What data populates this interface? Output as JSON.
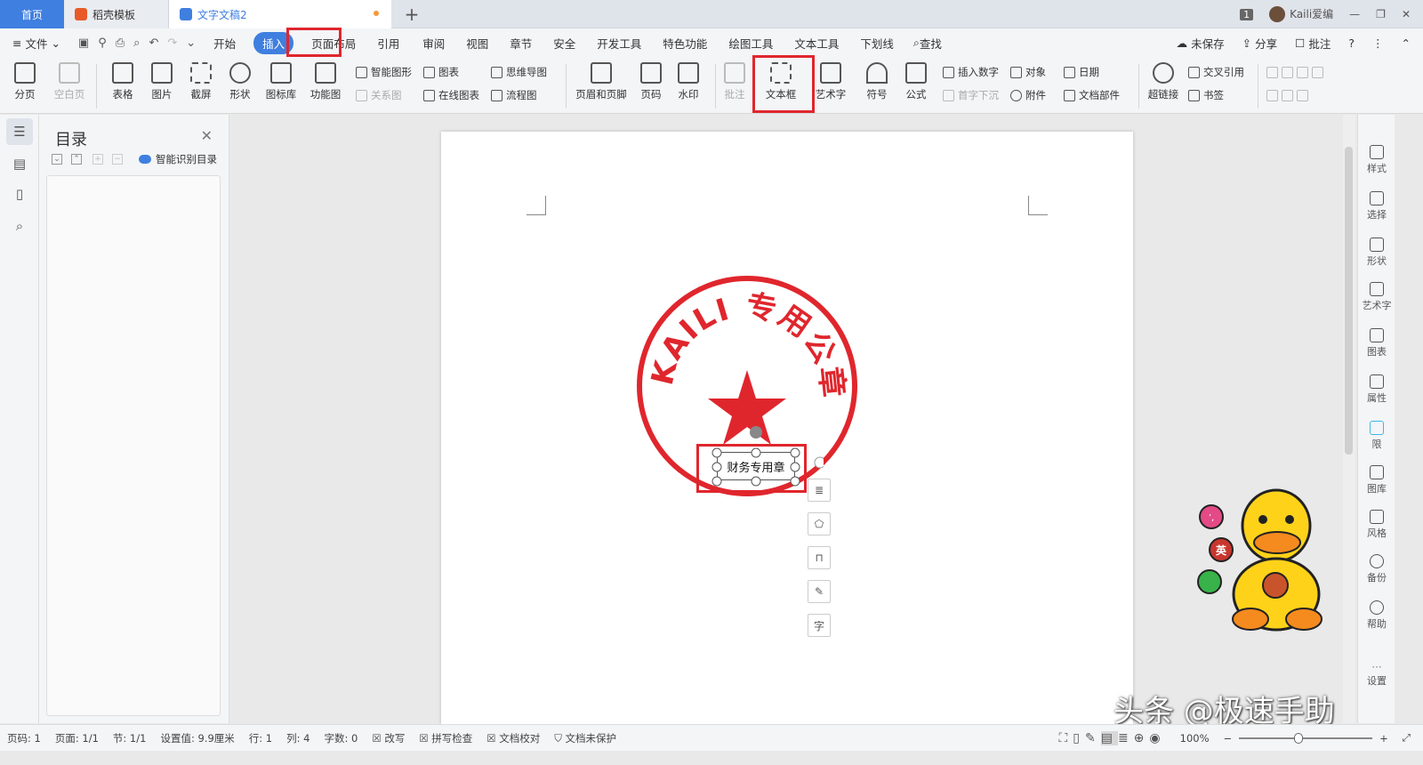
{
  "tabs": {
    "home": "首页",
    "templates": "稻壳模板",
    "doc": "文字文稿2"
  },
  "window": {
    "badge": "1",
    "user": "Kaili爱编"
  },
  "menu": {
    "file": "文件",
    "items": [
      "开始",
      "插入",
      "页面布局",
      "引用",
      "审阅",
      "视图",
      "章节",
      "安全",
      "开发工具",
      "特色功能",
      "绘图工具",
      "文本工具",
      "下划线"
    ],
    "find": "查找",
    "unsaved": "未保存",
    "share": "分享",
    "comment": "批注",
    "help": "?"
  },
  "ribbon": {
    "page_break": "分页",
    "blank_page": "空白页",
    "table": "表格",
    "picture": "图片",
    "screenshot": "截屏",
    "shape": "形状",
    "icon_lib": "图标库",
    "func_chart": "功能图",
    "smart_graphic": "智能图形",
    "chart": "图表",
    "mindmap": "思维导图",
    "relation": "关系图",
    "online_chart": "在线图表",
    "flowchart": "流程图",
    "header_footer": "页眉和页脚",
    "page_num": "页码",
    "watermark": "水印",
    "annotate": "批注",
    "textbox": "文本框",
    "wordart": "艺术字",
    "symbol": "符号",
    "formula": "公式",
    "insert_number": "插入数字",
    "object": "对象",
    "date": "日期",
    "drop_cap": "首字下沉",
    "attachment": "附件",
    "doc_parts": "文档部件",
    "hyperlink": "超链接",
    "cross_ref": "交叉引用",
    "bookmark": "书签"
  },
  "toc": {
    "title": "目录",
    "smart": "智能识别目录"
  },
  "seal": {
    "top_text": "KAILI 专用公章",
    "box_text": "财务专用章",
    "color": "#e0262d"
  },
  "right_panel": [
    "样式",
    "选择",
    "形状",
    "艺术字",
    "图表",
    "属性",
    "限",
    "图库",
    "风格",
    "备份",
    "帮助",
    "设置"
  ],
  "float_tools": [
    "layout-icon",
    "fill-icon",
    "border-icon",
    "pen-icon",
    "text-wrap-icon"
  ],
  "float_text": "字",
  "sticker": {
    "b1": "’,",
    "b2": "英"
  },
  "status": {
    "page": "页码: 1",
    "pages": "页面: 1/1",
    "section": "节: 1/1",
    "setting": "设置值: 9.9厘米",
    "row": "行: 1",
    "col": "列: 4",
    "words": "字数: 0",
    "revise": "改写",
    "spell": "拼写检查",
    "proof": "文档校对",
    "protect": "文档未保护",
    "zoom": "100%"
  },
  "watermark_text": "头条 @极速手助"
}
